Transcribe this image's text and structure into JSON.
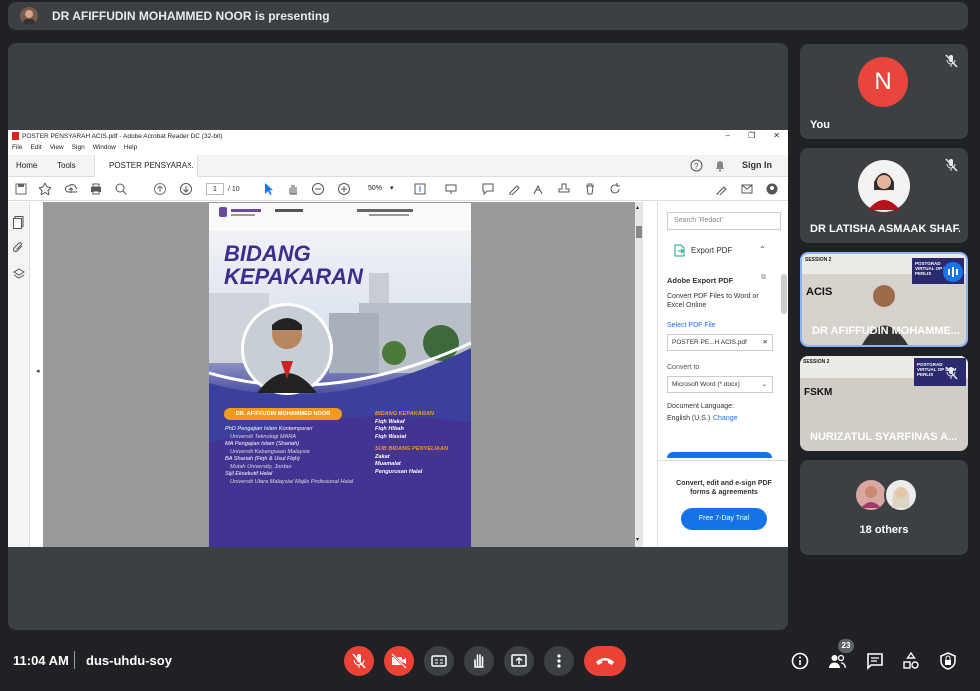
{
  "header": {
    "presenter_text": "DR AFIFFUDIN MOHAMMED NOOR is presenting"
  },
  "acrobat": {
    "window_title": "POSTER PENSYARAH ACIS.pdf - Adobe Acrobat Reader DC (32-bit)",
    "menu": [
      "File",
      "Edit",
      "View",
      "Sign",
      "Window",
      "Help"
    ],
    "tabs": {
      "home": "Home",
      "tools": "Tools",
      "document": "POSTER PENSYARA..."
    },
    "sign_in": "Sign In",
    "page_current": "1",
    "page_total": "/ 10",
    "zoom": "50%"
  },
  "poster": {
    "title_line1": "BIDANG",
    "title_line2": "KEPAKARAN",
    "name_banner": "DR. AFIFFUDIN MOHAMMED NOOR",
    "education": [
      {
        "degree": "PhD Pengajian Islam Kontemporari",
        "school": "Universiti Teknologi MARA"
      },
      {
        "degree": "MA Pengajian Islam (Shariah)",
        "school": "Universiti Kebangsaan Malaysia"
      },
      {
        "degree": "BA Shariah (Fiqh & Usul Fiqh)",
        "school": "Mutah University, Jordan"
      },
      {
        "degree": "Sijil Eksekutif Halal",
        "school": "Universiti Utara Malaysia/ Majlis Profesional Halal"
      }
    ],
    "expertise_heading": "BIDANG KEPAKARAN",
    "expertise": [
      "Fiqh Wakaf",
      "Fiqh Hibah",
      "Fiqh Wasiat"
    ],
    "sub_heading": "SUB BIDANG PENYELIAAN",
    "sub_items": [
      "Zakat",
      "Muamalat",
      "Pengurusan Halal"
    ]
  },
  "right_panel": {
    "search_placeholder": "Search 'Redact'",
    "export_pdf": "Export PDF",
    "adobe_export": "Adobe Export PDF",
    "convert_desc": "Convert PDF Files to Word or Excel Online",
    "select_pdf": "Select PDF File",
    "file_name": "POSTER PE...H ACIS.pdf",
    "convert_to": "Convert to",
    "convert_option": "Microsoft Word (*.docx)",
    "doc_language": "Document Language:",
    "language": "English (U.S.)",
    "change": "Change",
    "promo": "Convert, edit and e-sign PDF forms & agreements",
    "trial_button": "Free 7-Day Trial"
  },
  "participants": [
    {
      "name": "You",
      "initial": "N",
      "color": "#e8453c"
    },
    {
      "name": "DR LATISHA ASMAAK SHAF..."
    },
    {
      "name": "DR AFIFFUDIN MOHAMME...",
      "slide_label": "ACIS",
      "session": "SESSION 2",
      "badge": "POSTGRAD VIRTUAL OP UITM PERLIS"
    },
    {
      "name": "NURIZATUL SYARFINAS A...",
      "slide_label": "FSKM",
      "session": "SESSION 2",
      "badge": "POSTGRAD VIRTUAL OP UITM PERLIS"
    }
  ],
  "others": {
    "label": "18 others"
  },
  "footer": {
    "time": "11:04 AM",
    "meeting_code": "dus-uhdu-soy",
    "participant_count": "23"
  },
  "colors": {
    "accent_red": "#ea4335",
    "tile_bg": "#3c4043",
    "page_bg": "#202124",
    "active_border": "#8ab4f8"
  }
}
